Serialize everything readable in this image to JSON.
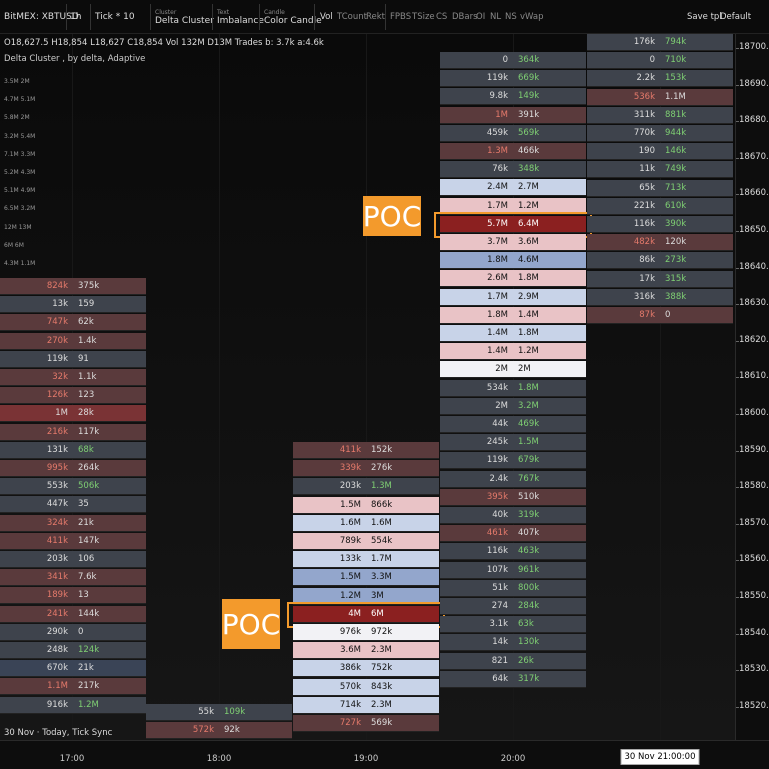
{
  "toolbar": {
    "symbol": "BitMEX: XBTUSD",
    "timeframe": "1h",
    "tick": "Tick * 10",
    "cluster_caption": "Cluster",
    "cluster_value": "Delta Cluster",
    "text_caption": "Text",
    "text_value": "Imbalance",
    "candle_caption": "Candle",
    "candle_value": "Color Candle",
    "toggles": [
      "Vol",
      "TCount",
      "Rekt",
      "FPBS",
      "TSize",
      "CS",
      "DBars",
      "OI",
      "NL",
      "NS",
      "vWap"
    ],
    "save_tpl": "Save tpl",
    "default": "Default"
  },
  "info": {
    "o": "O18,627.5",
    "h": "H18,854",
    "l": "L18,627",
    "c": "C18,854",
    "vol": "Vol 132M",
    "d": "D13M",
    "trades": "Trades b: 3.7k a:4.6k",
    "subtitle": "Delta Cluster , by delta, Adaptive"
  },
  "yaxis": [
    "18700.0",
    "18690.0",
    "18680.0",
    "18670.0",
    "18660.0",
    "18650.0",
    "18640.0",
    "18630.0",
    "18620.0",
    "18610.0",
    "18600.0",
    "18590.0",
    "18580.0",
    "18570.0",
    "18560.0",
    "18550.0",
    "18540.0",
    "18530.0",
    "18520.0"
  ],
  "xaxis": [
    "17:00",
    "18:00",
    "19:00",
    "20:00",
    "30 Nov 21:00:00"
  ],
  "bottom_status": "30 Nov  · Today, Tick Sync",
  "poc_label": "POC",
  "left_col_labels": [
    "3.5M 2M",
    "4.7M 5.1M",
    "5.8M 2M",
    "3.2M 5.4M",
    "7.1M 3.3M",
    "5.2M 4.3M",
    "5.1M 4.9M",
    "6.5M 3.2M",
    "12M 13M",
    "6M 6M",
    "4.3M 1.1M"
  ],
  "col17": [
    [
      "824k",
      "375k",
      "dred"
    ],
    [
      "13k",
      "159",
      "dgray"
    ],
    [
      "747k",
      "62k",
      "dred"
    ],
    [
      "270k",
      "1.4k",
      "dred"
    ],
    [
      "119k",
      "91",
      "dgray"
    ],
    [
      "32k",
      "1.1k",
      "dred"
    ],
    [
      "126k",
      "123",
      "dred"
    ],
    [
      "1M",
      "28k",
      "red"
    ],
    [
      "216k",
      "117k",
      "dred"
    ],
    [
      "131k",
      "68k",
      "dgray"
    ],
    [
      "995k",
      "264k",
      "dred"
    ],
    [
      "553k",
      "506k",
      "dgray"
    ],
    [
      "447k",
      "35",
      "dgray"
    ],
    [
      "324k",
      "21k",
      "dred"
    ],
    [
      "411k",
      "147k",
      "dred"
    ],
    [
      "203k",
      "106",
      "dgray"
    ],
    [
      "341k",
      "7.6k",
      "dred"
    ],
    [
      "189k",
      "13",
      "dred"
    ],
    [
      "241k",
      "144k",
      "dred"
    ],
    [
      "290k",
      "0",
      "dgray"
    ],
    [
      "248k",
      "124k",
      "dgray"
    ],
    [
      "670k",
      "21k",
      "dblue"
    ],
    [
      "1.1M",
      "217k",
      "dred"
    ],
    [
      "916k",
      "1.2M",
      "dgray"
    ]
  ],
  "col18": [
    [
      "55k",
      "109k",
      "dgray"
    ],
    [
      "572k",
      "92k",
      "dred"
    ]
  ],
  "col19": [
    [
      "411k",
      "152k",
      "dred"
    ],
    [
      "339k",
      "276k",
      "dred"
    ],
    [
      "203k",
      "1.3M",
      "dgray"
    ],
    [
      "1.5M",
      "866k",
      "pink"
    ],
    [
      "1.6M",
      "1.6M",
      "lblue"
    ],
    [
      "789k",
      "554k",
      "pink"
    ],
    [
      "133k",
      "1.7M",
      "lblue"
    ],
    [
      "1.5M",
      "3.3M",
      "blue"
    ],
    [
      "1.2M",
      "3M",
      "blue"
    ],
    [
      "4M",
      "6M",
      "poc"
    ],
    [
      "976k",
      "972k",
      "white"
    ],
    [
      "3.6M",
      "2.3M",
      "pink"
    ],
    [
      "386k",
      "752k",
      "lblue"
    ],
    [
      "570k",
      "843k",
      "lblue"
    ],
    [
      "714k",
      "2.3M",
      "lblue"
    ],
    [
      "727k",
      "569k",
      "dred"
    ]
  ],
  "col20": [
    [
      "0",
      "364k",
      "dgray"
    ],
    [
      "119k",
      "669k",
      "dgray"
    ],
    [
      "9.8k",
      "149k",
      "dgray"
    ],
    [
      "1M",
      "391k",
      "dred"
    ],
    [
      "459k",
      "569k",
      "dgray"
    ],
    [
      "1.3M",
      "466k",
      "dred"
    ],
    [
      "76k",
      "348k",
      "dgray"
    ],
    [
      "2.4M",
      "2.7M",
      "lblue"
    ],
    [
      "1.7M",
      "1.2M",
      "pink"
    ],
    [
      "5.7M",
      "6.4M",
      "poc"
    ],
    [
      "3.7M",
      "3.6M",
      "pink"
    ],
    [
      "1.8M",
      "4.6M",
      "blue"
    ],
    [
      "2.6M",
      "1.8M",
      "pink"
    ],
    [
      "1.7M",
      "2.9M",
      "lblue"
    ],
    [
      "1.8M",
      "1.4M",
      "pink"
    ],
    [
      "1.4M",
      "1.8M",
      "lblue"
    ],
    [
      "1.4M",
      "1.2M",
      "pink"
    ],
    [
      "2M",
      "2M",
      "white"
    ],
    [
      "534k",
      "1.8M",
      "dgray"
    ],
    [
      "2M",
      "3.2M",
      "dgray"
    ],
    [
      "44k",
      "469k",
      "dgray"
    ],
    [
      "245k",
      "1.5M",
      "dgray"
    ],
    [
      "119k",
      "679k",
      "dgray"
    ],
    [
      "2.4k",
      "767k",
      "dgray"
    ],
    [
      "395k",
      "510k",
      "dred"
    ],
    [
      "40k",
      "319k",
      "dgray"
    ],
    [
      "461k",
      "407k",
      "dred"
    ],
    [
      "116k",
      "463k",
      "dgray"
    ],
    [
      "107k",
      "961k",
      "dgray"
    ],
    [
      "51k",
      "800k",
      "dgray"
    ],
    [
      "274",
      "284k",
      "dgray"
    ],
    [
      "3.1k",
      "63k",
      "dgray"
    ],
    [
      "14k",
      "130k",
      "dgray"
    ],
    [
      "821",
      "26k",
      "dgray"
    ],
    [
      "64k",
      "317k",
      "dgray"
    ]
  ],
  "col21": [
    [
      "176k",
      "794k",
      "dgray"
    ],
    [
      "0",
      "710k",
      "dgray"
    ],
    [
      "2.2k",
      "153k",
      "dgray"
    ],
    [
      "536k",
      "1.1M",
      "dred"
    ],
    [
      "311k",
      "881k",
      "dgray"
    ],
    [
      "770k",
      "944k",
      "dgray"
    ],
    [
      "190",
      "146k",
      "dgray"
    ],
    [
      "11k",
      "749k",
      "dgray"
    ],
    [
      "65k",
      "713k",
      "dgray"
    ],
    [
      "221k",
      "610k",
      "dgray"
    ],
    [
      "116k",
      "390k",
      "dgray"
    ],
    [
      "482k",
      "120k",
      "dred"
    ],
    [
      "86k",
      "273k",
      "dgray"
    ],
    [
      "17k",
      "315k",
      "dgray"
    ],
    [
      "316k",
      "388k",
      "dgray"
    ],
    [
      "87k",
      "0",
      "dred"
    ]
  ]
}
